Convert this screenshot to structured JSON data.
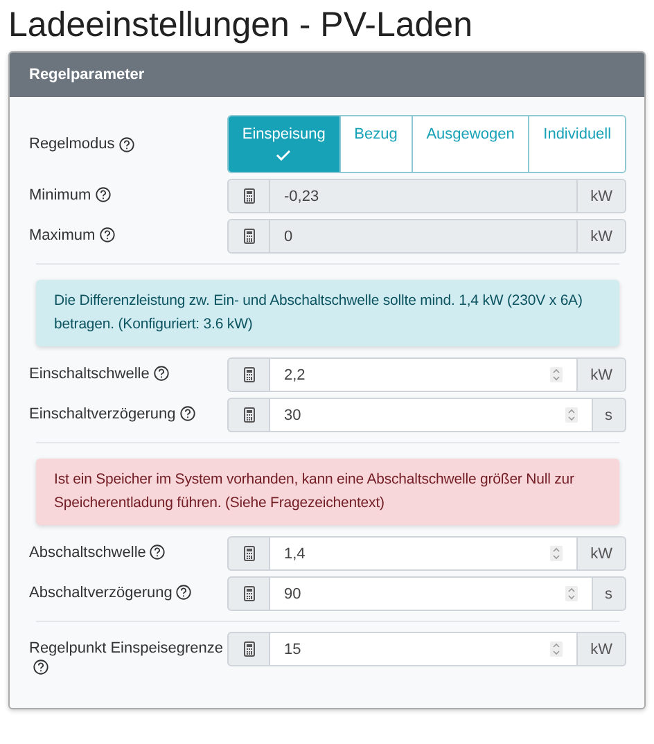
{
  "title": "Ladeeinstellungen - PV-Laden",
  "card": {
    "header": "Regelparameter",
    "rows": [
      {
        "kind": "mode",
        "label": "Regelmodus",
        "options": [
          {
            "label": "Einspeisung",
            "selected": true
          },
          {
            "label": "Bezug",
            "selected": false
          },
          {
            "label": "Ausgewogen",
            "selected": false
          },
          {
            "label": "Individuell",
            "selected": false
          }
        ]
      },
      {
        "kind": "input",
        "label": "Minimum",
        "value": "-0,23",
        "unit": "kW",
        "disabled": true
      },
      {
        "kind": "input",
        "label": "Maximum",
        "value": "0",
        "unit": "kW",
        "disabled": true
      },
      {
        "kind": "separator"
      },
      {
        "kind": "alert",
        "color": "#d1ecf1",
        "text": "Die Differenzleistung zw. Ein- und Abschaltschwelle sollte mind. 1,4 kW (230V x 6A) betragen. (Konfiguriert: 3.6 kW)"
      },
      {
        "kind": "input",
        "label": "Einschaltschwelle",
        "value": "2,2",
        "unit": "kW",
        "disabled": false
      },
      {
        "kind": "input",
        "label": "Einschaltverzögerung",
        "value": "30",
        "unit": "s",
        "disabled": false
      },
      {
        "kind": "separator"
      },
      {
        "kind": "alert",
        "color": "#f8d7da",
        "text": "Ist ein Speicher im System vorhanden, kann eine Abschaltschwelle größer Null zur Speicherentladung führen. (Siehe Fragezeichentext)"
      },
      {
        "kind": "input",
        "label": "Abschaltschwelle",
        "value": "1,4",
        "unit": "kW",
        "disabled": false
      },
      {
        "kind": "input",
        "label": "Abschaltverzögerung",
        "value": "90",
        "unit": "s",
        "disabled": false
      },
      {
        "kind": "separator"
      },
      {
        "kind": "input",
        "label": "Regelpunkt Einspeisegrenze",
        "value": "15",
        "unit": "kW",
        "disabled": false
      }
    ]
  }
}
